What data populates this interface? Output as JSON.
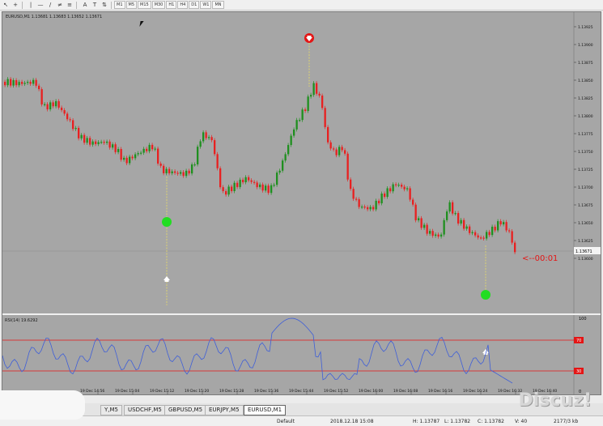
{
  "toolbar": {
    "icons": [
      "cursor-icon",
      "crosshair-icon",
      "vertical-line-icon",
      "horizontal-line-icon",
      "trendline-icon",
      "channel-icon",
      "fibonacci-icon",
      "text-icon",
      "label-icon",
      "arrows-icon"
    ],
    "glyphs": [
      "↖",
      "+",
      "|",
      "—",
      "/",
      "≠",
      "≡",
      "A",
      "T",
      "⇅"
    ],
    "timeframes": [
      "M1",
      "M5",
      "M15",
      "M30",
      "H1",
      "H4",
      "D1",
      "W1",
      "MN"
    ]
  },
  "chart": {
    "header": "EURUSD,M1  1.13681 1.13683 1.13652 1.13671",
    "price_labels": [
      "1.13925",
      "1.13900",
      "1.13875",
      "1.13850",
      "1.13825",
      "1.13800",
      "1.13775",
      "1.13750",
      "1.13725",
      "1.13700",
      "1.13675",
      "1.13650",
      "1.13625",
      "1.13600"
    ],
    "current_price": "1.13671",
    "countdown": "<--00:01",
    "colors": {
      "bg": "#a6a6a6",
      "bull": "#1f8f1f",
      "bear": "#e82020",
      "up_signal": "#22dd22",
      "down_signal": "#e41515",
      "dotline": "#f2e55c"
    }
  },
  "rsi": {
    "label": "RSI(14) 19.6292",
    "levels": [
      "100",
      "70",
      "30",
      "0"
    ],
    "line_color": "#3f5fd8"
  },
  "time_axis": [
    "19 Dec 14:56",
    "19 Dec 15:04",
    "19 Dec 15:12",
    "19 Dec 15:20",
    "19 Dec 15:28",
    "19 Dec 15:36",
    "19 Dec 15:44",
    "19 Dec 15:52",
    "19 Dec 16:00",
    "19 Dec 16:08",
    "19 Dec 16:16",
    "19 Dec 16:24",
    "19 Dec 16:32",
    "19 Dec 16:40"
  ],
  "tabs": [
    "Y,M5",
    "USDCHF,M5",
    "GBPUSD,M5",
    "EURJPY,M5",
    "EURUSD,M1"
  ],
  "active_tab": 4,
  "status": {
    "profile": "Default",
    "datetime": "2018.12.18 15:08",
    "high": "H: 1.13787",
    "low": "L: 1.13782",
    "close": "C: 1.13782",
    "volume": "V: 40",
    "traffic": "2177/3 kb"
  },
  "watermark": "Discuz!"
}
